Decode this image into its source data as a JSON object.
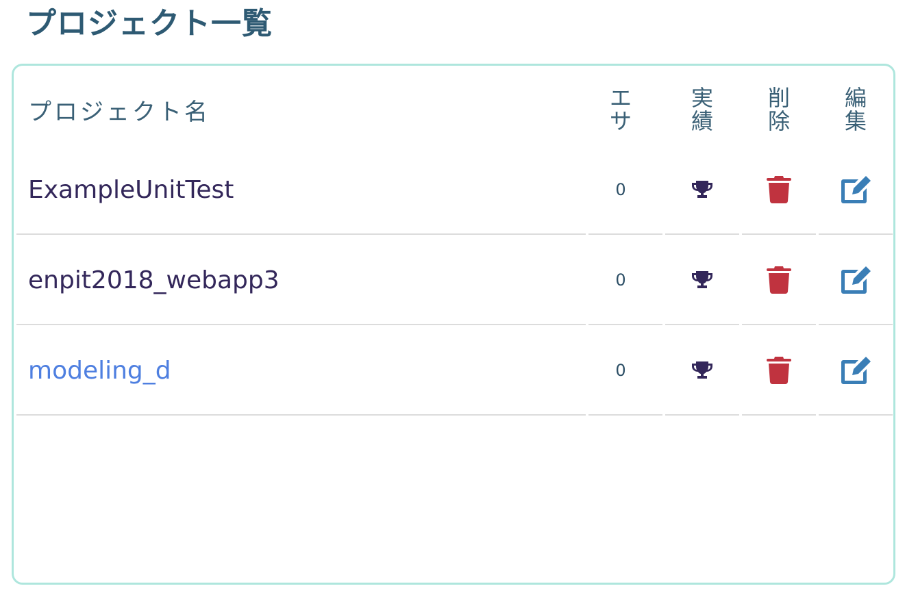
{
  "page": {
    "title": "プロジェクト一覧"
  },
  "table": {
    "headers": {
      "name": "プロジェクト名",
      "esa": [
        "エ",
        "サ"
      ],
      "jisseki": [
        "実",
        "績"
      ],
      "delete": [
        "削",
        "除"
      ],
      "edit": [
        "編",
        "集"
      ]
    },
    "rows": [
      {
        "name": "ExampleUnitTest",
        "esa": "0",
        "link": false
      },
      {
        "name": "enpit2018_webapp3",
        "esa": "0",
        "link": false
      },
      {
        "name": "modeling_d",
        "esa": "0",
        "link": true
      }
    ]
  },
  "icons": {
    "results": "trophy-icon",
    "delete": "trash-icon",
    "edit": "edit-icon"
  },
  "colors": {
    "title": "#2e5a73",
    "panel_border": "#aee6dd",
    "trophy": "#33275a",
    "trash": "#c0333f",
    "edit": "#3a7eb6",
    "link": "#4e7fe0"
  }
}
